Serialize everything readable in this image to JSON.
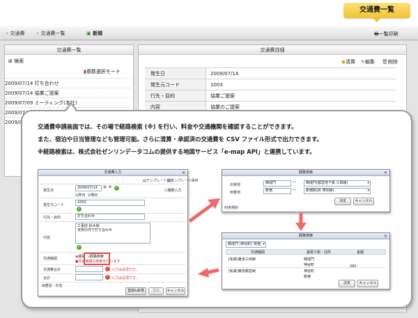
{
  "title_tab": "交通費一覧",
  "toolbar": {
    "crumb1": "交通費",
    "crumb2": "交通費一覧",
    "new_label": "新規",
    "print_label": "一覧印刷"
  },
  "left_panel": {
    "title": "交通費一覧",
    "search_label": "検索",
    "multi_select_label": "複数選択モード",
    "rows": [
      {
        "date": "2009/07/14",
        "text": "打ち合わせ"
      },
      {
        "date": "2009/07/14",
        "text": "協業ご提案"
      },
      {
        "date": "2009/07/09",
        "text": "ミーティング(本社)"
      },
      {
        "date": "2009/07/08",
        "text": ""
      },
      {
        "date": "2009/07/07",
        "text": ""
      }
    ]
  },
  "right_panel": {
    "title": "交通費詳細",
    "actions": {
      "settle": "清算",
      "edit": "編集",
      "delete": "削除"
    },
    "rows": [
      {
        "key": "発生日",
        "value": "2009/07/14"
      },
      {
        "key": "発生元コード",
        "value": "1003"
      },
      {
        "key": "行先・目的",
        "value": "協業ご提案"
      },
      {
        "key": "内容",
        "value": "協業のご提案"
      }
    ]
  },
  "description": {
    "line1": "交通費申請画面では、その場で経路検索 (※) を行い、料金や交通機関を確認することができます。",
    "line2": "また、宿泊や日当管理なども管理可能。さらに清算・承認済の交通費を CSV ファイル形式で出力できます。",
    "line3": "※経路検索は、株式会社ゼンリンデータコムの提供する地図サービス「e-map API」と連携しています。"
  },
  "dialog_input": {
    "title": "交通費入力",
    "template_link": "テンプレート読込",
    "template_save": "テンプレート保存",
    "occur_date_label": "発生日",
    "occur_date_value": "2009/07/14",
    "repeat_label": "複数入力",
    "chk1": "昨日",
    "chk2": "明日",
    "code_label": "発生元コード",
    "code_value": "1002",
    "dest_label": "行先・目的",
    "dest_value": "打ち合わせ",
    "content_label": "内容",
    "content_value1": "工事店 鈴木様",
    "content_value2": "定例の件で打ち合わせ",
    "route_label": "交通機関",
    "route_btn1": "経路",
    "route_btn2": "経路検索",
    "route_note": "交通機関の検索を行います",
    "fare_label": "交通費合計",
    "fare_error": "入力は必須です。",
    "total_label": "合計",
    "total_error": "入力は必須です。",
    "add_link": "宿泊・日当",
    "btn_save_continue": "登録&新規",
    "btn_save": "登録",
    "btn_cancel": "キャンセル"
  },
  "dialog_search": {
    "title": "経路検索",
    "from_label": "出発地",
    "from_station": "御成門",
    "from_select": "御成門(都営地下鉄 三田線)",
    "to_label": "到着地",
    "to_station": "新宿",
    "to_select": "新宿駅(JR 埼京線)",
    "link": "利用規約",
    "btn_ok": "決定",
    "btn_cancel": "キャンセル"
  },
  "dialog_result": {
    "title": "経路検索",
    "select_value": "御成門 (神谷町) 新宿",
    "col1": "交通機関",
    "col2": "最寄り駅・住所",
    "col3": "金額",
    "rows": [
      {
        "line": "[私鉄]東京三田線",
        "stop": "御成門"
      },
      {
        "line": "",
        "stop": "神谷町"
      },
      {
        "line": "[私鉄]東京都営線",
        "stop": "神谷町"
      },
      {
        "line": "",
        "stop": "新宿"
      }
    ],
    "fare": "260",
    "btn_ok": "決定",
    "btn_cancel": "キャンセル"
  },
  "colors": {
    "accent": "#f2c233",
    "arrow": "#ee6a6a",
    "error": "#e04a3c",
    "ok": "#4caf30"
  }
}
